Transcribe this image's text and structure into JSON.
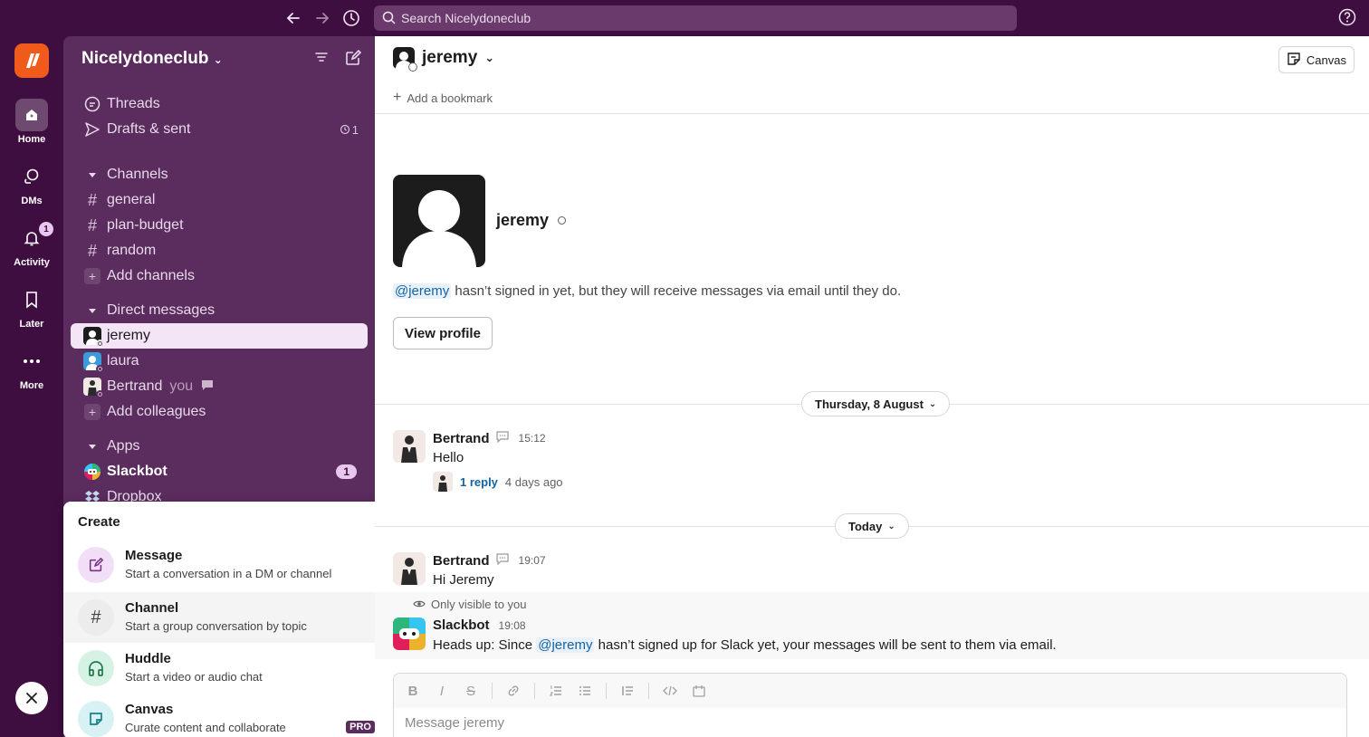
{
  "search": {
    "placeholder": "Search Nicelydoneclub"
  },
  "rail": {
    "items": [
      {
        "label": "Home"
      },
      {
        "label": "DMs"
      },
      {
        "label": "Activity",
        "badge": "1"
      },
      {
        "label": "Later"
      },
      {
        "label": "More"
      }
    ]
  },
  "sidebar": {
    "workspace": "Nicelydoneclub",
    "threads": "Threads",
    "drafts": "Drafts & sent",
    "drafts_count": "1",
    "channels_header": "Channels",
    "channels": [
      "general",
      "plan-budget",
      "random"
    ],
    "add_channels": "Add channels",
    "dm_header": "Direct messages",
    "dms": [
      {
        "name": "jeremy"
      },
      {
        "name": "laura"
      },
      {
        "name": "Bertrand",
        "suffix": "you"
      }
    ],
    "add_colleagues": "Add colleagues",
    "apps_header": "Apps",
    "apps": [
      {
        "name": "Slackbot",
        "badge": "1"
      },
      {
        "name": "Dropbox"
      }
    ]
  },
  "create_menu": {
    "title": "Create",
    "items": [
      {
        "title": "Message",
        "desc": "Start a conversation in a DM or channel"
      },
      {
        "title": "Channel",
        "desc": "Start a group conversation by topic"
      },
      {
        "title": "Huddle",
        "desc": "Start a video or audio chat"
      },
      {
        "title": "Canvas",
        "desc": "Curate content and collaborate",
        "badge": "PRO"
      }
    ]
  },
  "channel": {
    "name": "jeremy",
    "add_bookmark": "Add a bookmark",
    "canvas_label": "Canvas"
  },
  "intro": {
    "name": "jeremy",
    "mention": "@jeremy",
    "text": " hasn’t signed in yet, but they will receive messages via email until they do.",
    "view_profile": "View profile"
  },
  "dates": {
    "first": "Thursday, 8 August",
    "second": "Today"
  },
  "messages": [
    {
      "author": "Bertrand",
      "time": "15:12",
      "text": "Hello",
      "reply_link": "1 reply",
      "reply_age": "4 days ago"
    },
    {
      "author": "Bertrand",
      "time": "19:07",
      "text": "Hi Jeremy"
    },
    {
      "visibility": "Only visible to you",
      "author": "Slackbot",
      "time": "19:08",
      "text_before": "Heads up: Since ",
      "mention": "@jeremy",
      "text_after": " hasn’t signed up for Slack yet, your messages will be sent to them via email."
    }
  ],
  "composer": {
    "placeholder": "Message jeremy"
  },
  "colors": {
    "aubergine": "#3f0e40",
    "sidebar": "#5b2c5e",
    "link": "#1264a3",
    "brand_logo": "#f05a1a"
  }
}
